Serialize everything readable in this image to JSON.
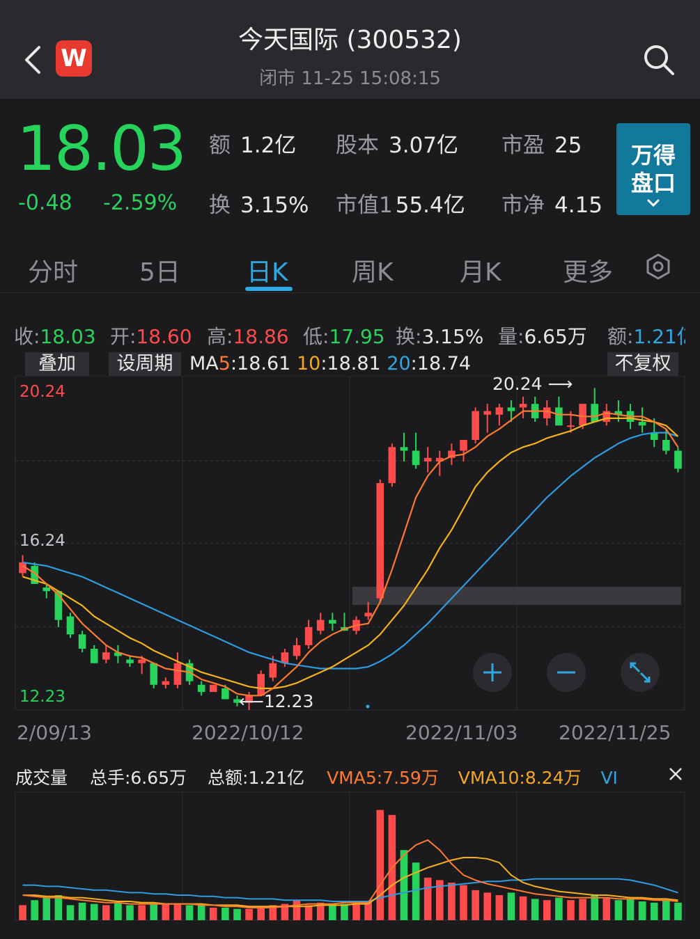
{
  "header": {
    "title": "今天国际 (300532)",
    "status": "闭市 11-25 15:08:15",
    "logo_letter": "W"
  },
  "quote": {
    "price": "18.03",
    "change": "-0.48",
    "change_pct": "-2.59%",
    "stats": [
      {
        "label": "额",
        "value": "1.2亿"
      },
      {
        "label": "股本",
        "value": "3.07亿"
      },
      {
        "label": "市盈",
        "value": "25"
      },
      {
        "label": "换",
        "value": "3.15%"
      },
      {
        "label": "市值1",
        "value": "55.4亿"
      },
      {
        "label": "市净",
        "value": "4.15"
      }
    ],
    "wind_button": {
      "line1": "万得",
      "line2": "盘口"
    }
  },
  "tabs": [
    {
      "label": "分时",
      "active": false
    },
    {
      "label": "5日",
      "active": false
    },
    {
      "label": "日K",
      "active": true
    },
    {
      "label": "周K",
      "active": false
    },
    {
      "label": "月K",
      "active": false
    },
    {
      "label": "更多",
      "active": false
    }
  ],
  "ohlc": {
    "close": {
      "label": "收:",
      "value": "18.03"
    },
    "open": {
      "label": "开:",
      "value": "18.60"
    },
    "high": {
      "label": "高:",
      "value": "18.86"
    },
    "low": {
      "label": "低:",
      "value": "17.95"
    },
    "turnover": {
      "label": "换:",
      "value": "3.15%"
    },
    "volume": {
      "label": "量:",
      "value": "6.65万"
    },
    "amount": {
      "label": "额:",
      "value": "1.21亿"
    }
  },
  "ma_bar": {
    "overlay_btn": "叠加",
    "period_btn": "设周期",
    "ma_prefix": "MA",
    "ma5_key": "5",
    "ma5_val": ":18.61",
    "ma10_key": "10",
    "ma10_val": ":18.81",
    "ma20_key": "20",
    "ma20_val": ":18.74",
    "adjust_btn": "不复权"
  },
  "colors": {
    "up": "#ff4b4b",
    "down": "#27d35b",
    "ma5": "#ff7a2e",
    "ma10": "#f5b21b",
    "ma20": "#2f9be0",
    "accent": "#2fa7e0"
  },
  "chart_data": {
    "type": "candlestick",
    "y_axis": {
      "top": "20.24",
      "mid": "16.24",
      "bottom": "12.23"
    },
    "annotations": {
      "high": "20.24 ⟶",
      "low": "⟵12.23"
    },
    "x_labels": [
      "2/09/13",
      "2022/10/12",
      "2022/11/03",
      "2022/11/25"
    ],
    "candles": [
      [
        15.1,
        15.6,
        15.0,
        15.4
      ],
      [
        15.3,
        15.4,
        14.8,
        14.8
      ],
      [
        14.7,
        14.8,
        14.4,
        14.6
      ],
      [
        14.6,
        14.6,
        13.6,
        13.8
      ],
      [
        13.9,
        14.0,
        13.3,
        13.4
      ],
      [
        13.4,
        13.5,
        12.9,
        13.0
      ],
      [
        13.0,
        13.1,
        12.6,
        12.6
      ],
      [
        12.7,
        13.1,
        12.6,
        12.9
      ],
      [
        12.9,
        13.1,
        12.6,
        12.8
      ],
      [
        12.7,
        12.8,
        12.5,
        12.6
      ],
      [
        12.6,
        12.8,
        12.3,
        12.7
      ],
      [
        12.6,
        12.6,
        11.9,
        12.0
      ],
      [
        12.0,
        12.2,
        11.9,
        12.1
      ],
      [
        12.0,
        12.9,
        11.9,
        12.6
      ],
      [
        12.6,
        12.7,
        12.0,
        12.1
      ],
      [
        12.0,
        12.1,
        11.7,
        11.8
      ],
      [
        11.8,
        12.0,
        11.8,
        12.0
      ],
      [
        11.9,
        12.0,
        11.6,
        11.6
      ],
      [
        11.6,
        11.7,
        11.4,
        11.5
      ],
      [
        11.5,
        11.8,
        11.3,
        11.7
      ],
      [
        11.7,
        12.4,
        11.7,
        12.3
      ],
      [
        12.2,
        12.8,
        12.1,
        12.6
      ],
      [
        12.6,
        13.0,
        12.5,
        12.9
      ],
      [
        12.8,
        13.3,
        12.7,
        13.1
      ],
      [
        13.1,
        13.8,
        13.0,
        13.6
      ],
      [
        13.5,
        14.0,
        13.4,
        13.8
      ],
      [
        13.8,
        14.0,
        13.5,
        13.7
      ],
      [
        13.6,
        14.0,
        13.5,
        13.5
      ],
      [
        13.5,
        13.9,
        13.4,
        13.8
      ],
      [
        13.9,
        14.3,
        13.8,
        14.0
      ],
      [
        14.4,
        17.7,
        14.3,
        17.6
      ],
      [
        17.6,
        18.7,
        17.5,
        18.6
      ],
      [
        18.6,
        19.0,
        18.2,
        18.5
      ],
      [
        18.5,
        19.0,
        18.0,
        18.1
      ],
      [
        18.2,
        18.6,
        17.9,
        18.3
      ],
      [
        18.2,
        18.5,
        17.8,
        18.3
      ],
      [
        18.3,
        18.7,
        18.1,
        18.5
      ],
      [
        18.5,
        18.8,
        18.2,
        18.8
      ],
      [
        18.8,
        19.7,
        18.7,
        19.6
      ],
      [
        19.5,
        19.8,
        19.0,
        19.6
      ],
      [
        19.5,
        19.8,
        19.2,
        19.7
      ],
      [
        19.7,
        19.9,
        19.3,
        19.6
      ],
      [
        19.7,
        20.0,
        19.4,
        19.8
      ],
      [
        19.8,
        20.0,
        19.3,
        19.4
      ],
      [
        19.4,
        19.9,
        19.2,
        19.7
      ],
      [
        19.7,
        20.0,
        19.2,
        19.2
      ],
      [
        19.2,
        19.6,
        19.0,
        19.2
      ],
      [
        19.2,
        19.8,
        19.1,
        19.8
      ],
      [
        19.8,
        20.24,
        19.3,
        19.3
      ],
      [
        19.3,
        19.8,
        19.2,
        19.6
      ],
      [
        19.6,
        19.9,
        19.3,
        19.5
      ],
      [
        19.6,
        19.8,
        19.1,
        19.3
      ],
      [
        19.3,
        19.7,
        19.0,
        19.2
      ],
      [
        19.0,
        19.4,
        18.6,
        18.8
      ],
      [
        18.8,
        19.1,
        18.4,
        18.5
      ],
      [
        18.5,
        18.6,
        17.9,
        18.0
      ]
    ],
    "ma5": [
      15.3,
      15.1,
      14.8,
      14.5,
      14.1,
      13.7,
      13.4,
      13.1,
      12.9,
      12.8,
      12.75,
      12.6,
      12.45,
      12.4,
      12.35,
      12.15,
      12.05,
      11.95,
      11.75,
      11.7,
      11.7,
      11.9,
      12.2,
      12.5,
      12.9,
      13.2,
      13.4,
      13.55,
      13.65,
      13.7,
      14.3,
      15.2,
      16.2,
      17.2,
      17.8,
      18.2,
      18.35,
      18.4,
      18.6,
      18.9,
      19.1,
      19.35,
      19.6,
      19.6,
      19.6,
      19.5,
      19.5,
      19.45,
      19.45,
      19.55,
      19.5,
      19.45,
      19.45,
      19.3,
      19.1,
      18.6
    ],
    "ma10": [
      15.0,
      14.9,
      14.8,
      14.6,
      14.4,
      14.2,
      13.9,
      13.7,
      13.5,
      13.3,
      13.15,
      12.95,
      12.8,
      12.65,
      12.5,
      12.35,
      12.25,
      12.15,
      12.05,
      11.95,
      11.9,
      11.9,
      11.95,
      12.05,
      12.2,
      12.35,
      12.5,
      12.7,
      12.9,
      13.1,
      13.4,
      13.8,
      14.2,
      14.7,
      15.2,
      15.8,
      16.3,
      16.9,
      17.5,
      17.9,
      18.2,
      18.45,
      18.6,
      18.7,
      18.85,
      18.95,
      19.05,
      19.2,
      19.3,
      19.4,
      19.4,
      19.4,
      19.35,
      19.3,
      19.2,
      18.9
    ],
    "ma20": [
      15.4,
      15.35,
      15.3,
      15.2,
      15.1,
      15.0,
      14.85,
      14.7,
      14.55,
      14.4,
      14.25,
      14.1,
      13.95,
      13.8,
      13.65,
      13.5,
      13.35,
      13.2,
      13.05,
      12.9,
      12.8,
      12.7,
      12.6,
      12.55,
      12.5,
      12.45,
      12.45,
      12.45,
      12.45,
      12.5,
      12.65,
      12.85,
      13.1,
      13.4,
      13.7,
      14.05,
      14.4,
      14.75,
      15.1,
      15.45,
      15.8,
      16.15,
      16.5,
      16.85,
      17.2,
      17.5,
      17.8,
      18.05,
      18.3,
      18.5,
      18.7,
      18.85,
      18.95,
      19.0,
      19.0,
      18.9
    ]
  },
  "volume": {
    "title": "成交量",
    "total_hands": "总手:6.65万",
    "total_amount": "总额:1.21亿",
    "vma5_key": "VMA5",
    "vma5_val": ":7.59万",
    "vma10_key": "VMA10",
    "vma10_val": ":8.24万",
    "vol_key": "VI",
    "bars": [
      0.12,
      0.16,
      0.18,
      0.2,
      0.12,
      0.14,
      0.13,
      0.12,
      0.14,
      0.12,
      0.12,
      0.14,
      0.13,
      0.13,
      0.12,
      0.12,
      0.1,
      0.1,
      0.09,
      0.09,
      0.1,
      0.12,
      0.13,
      0.16,
      0.12,
      0.14,
      0.13,
      0.13,
      0.14,
      0.15,
      0.88,
      0.84,
      0.56,
      0.46,
      0.34,
      0.32,
      0.3,
      0.28,
      0.24,
      0.22,
      0.2,
      0.22,
      0.19,
      0.17,
      0.16,
      0.18,
      0.16,
      0.17,
      0.2,
      0.18,
      0.16,
      0.17,
      0.15,
      0.14,
      0.16,
      0.14
    ],
    "vma5": [
      0.2,
      0.19,
      0.18,
      0.18,
      0.17,
      0.16,
      0.15,
      0.14,
      0.14,
      0.13,
      0.13,
      0.13,
      0.13,
      0.13,
      0.13,
      0.12,
      0.12,
      0.11,
      0.11,
      0.1,
      0.1,
      0.1,
      0.11,
      0.12,
      0.13,
      0.13,
      0.13,
      0.14,
      0.14,
      0.14,
      0.28,
      0.42,
      0.52,
      0.6,
      0.64,
      0.56,
      0.45,
      0.36,
      0.32,
      0.29,
      0.27,
      0.25,
      0.23,
      0.21,
      0.2,
      0.19,
      0.18,
      0.18,
      0.18,
      0.18,
      0.17,
      0.17,
      0.17,
      0.16,
      0.16,
      0.15
    ],
    "vma10": [
      0.2,
      0.2,
      0.19,
      0.19,
      0.18,
      0.18,
      0.17,
      0.16,
      0.15,
      0.15,
      0.14,
      0.14,
      0.13,
      0.13,
      0.13,
      0.13,
      0.12,
      0.12,
      0.12,
      0.11,
      0.11,
      0.11,
      0.11,
      0.11,
      0.11,
      0.12,
      0.12,
      0.12,
      0.13,
      0.13,
      0.2,
      0.28,
      0.34,
      0.38,
      0.42,
      0.45,
      0.48,
      0.5,
      0.5,
      0.49,
      0.46,
      0.36,
      0.3,
      0.27,
      0.25,
      0.23,
      0.22,
      0.21,
      0.2,
      0.2,
      0.19,
      0.18,
      0.18,
      0.17,
      0.17,
      0.16
    ],
    "vol_line": [
      0.28,
      0.28,
      0.27,
      0.27,
      0.26,
      0.25,
      0.24,
      0.24,
      0.23,
      0.22,
      0.22,
      0.21,
      0.21,
      0.2,
      0.2,
      0.19,
      0.19,
      0.18,
      0.18,
      0.17,
      0.17,
      0.17,
      0.16,
      0.16,
      0.16,
      0.16,
      0.15,
      0.15,
      0.15,
      0.15,
      0.18,
      0.2,
      0.22,
      0.24,
      0.26,
      0.27,
      0.28,
      0.29,
      0.3,
      0.31,
      0.31,
      0.32,
      0.32,
      0.33,
      0.33,
      0.33,
      0.33,
      0.33,
      0.33,
      0.33,
      0.33,
      0.32,
      0.3,
      0.28,
      0.25,
      0.22
    ]
  }
}
